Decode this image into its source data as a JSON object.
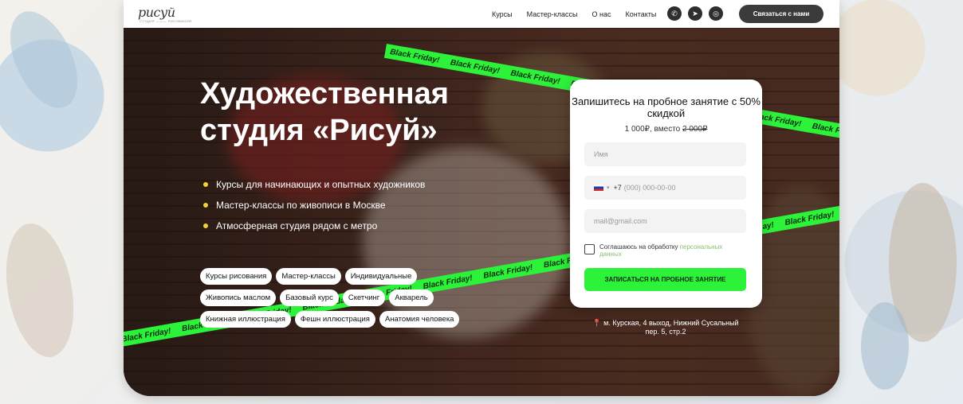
{
  "header": {
    "logo_name": "рисуй",
    "logo_sub": "СТУДИЯ ——— РИСОВАНИЯ",
    "nav": [
      "Курсы",
      "Мастер-классы",
      "О нас",
      "Контакты"
    ],
    "social_icons": [
      "whatsapp-icon",
      "telegram-icon",
      "instagram-icon"
    ],
    "contact_button": "Связаться с нами"
  },
  "hero": {
    "title_line1": "Художественная",
    "title_line2": "студия «Рисуй»",
    "features": [
      "Курсы для начинающих и опытных художников",
      "Мастер-классы по живописи в Москве",
      "Атмосферная студия рядом с метро"
    ],
    "chips_row1": [
      "Курсы рисования",
      "Мастер-классы",
      "Индивидуальные"
    ],
    "chips_row2": [
      "Живопись маслом",
      "Базовый курс",
      "Скетчинг",
      "Акварель"
    ],
    "chips_row3": [
      "Книжная иллюстрация",
      "Фешн иллюстрация",
      "Анатомия человека"
    ],
    "promo_tape_text": "Black Friday!"
  },
  "form": {
    "title": "Запишитесь на пробное занятие с 50% скидкой",
    "price_new": "1 000₽, вместо ",
    "price_old": "2 000₽",
    "name_placeholder": "Имя",
    "phone_prefix": "+7",
    "phone_placeholder": "(000) 000-00-00",
    "email_placeholder": "mail@gmail.com",
    "consent_text": "Соглашаюсь на обработку ",
    "consent_link": "персональных данных",
    "submit_label": "ЗАПИСАТЬСЯ НА ПРОБНОЕ ЗАНЯТИЕ"
  },
  "address": {
    "text": "м. Курская, 4 выход, Нижний Сусальный пер. 5, стр.2"
  },
  "colors": {
    "accent_green": "#2df23a",
    "bullet_yellow": "#f2d23a",
    "dark_button": "#3b3b3b"
  }
}
